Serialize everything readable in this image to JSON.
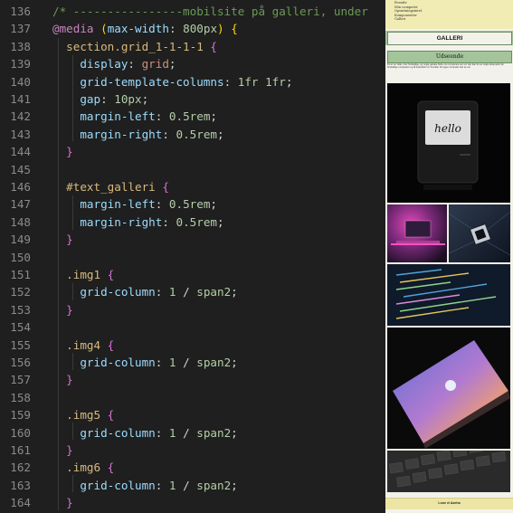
{
  "editor": {
    "lines": [
      {
        "n": "136",
        "tokens": [
          [
            "/* ----------------mobilsite på galleri, under ",
            "c-comment"
          ]
        ]
      },
      {
        "n": "137",
        "tokens": [
          [
            "@media",
            "c-at"
          ],
          [
            " ",
            "c-punc"
          ],
          [
            "(",
            "c-paren"
          ],
          [
            "max-width",
            "c-prop"
          ],
          [
            ": ",
            "c-punc"
          ],
          [
            "800px",
            "c-num"
          ],
          [
            ")",
            "c-paren"
          ],
          [
            " ",
            "c-punc"
          ],
          [
            "{",
            "c-paren"
          ]
        ]
      },
      {
        "n": "138",
        "tokens": [
          [
            "  section.grid_1-1-1-1",
            "c-sel"
          ],
          [
            " ",
            "c-punc"
          ],
          [
            "{",
            "c-brace"
          ]
        ]
      },
      {
        "n": "139",
        "tokens": [
          [
            "    display",
            "c-prop"
          ],
          [
            ": ",
            "c-punc"
          ],
          [
            "grid",
            "c-val"
          ],
          [
            ";",
            "c-punc"
          ]
        ]
      },
      {
        "n": "140",
        "tokens": [
          [
            "    grid-template-columns",
            "c-prop"
          ],
          [
            ": ",
            "c-punc"
          ],
          [
            "1fr 1fr",
            "c-num"
          ],
          [
            ";",
            "c-punc"
          ]
        ]
      },
      {
        "n": "141",
        "tokens": [
          [
            "    gap",
            "c-prop"
          ],
          [
            ": ",
            "c-punc"
          ],
          [
            "10px",
            "c-num"
          ],
          [
            ";",
            "c-punc"
          ]
        ]
      },
      {
        "n": "142",
        "tokens": [
          [
            "    margin-left",
            "c-prop"
          ],
          [
            ": ",
            "c-punc"
          ],
          [
            "0.5rem",
            "c-num"
          ],
          [
            ";",
            "c-punc"
          ]
        ]
      },
      {
        "n": "143",
        "tokens": [
          [
            "    margin-right",
            "c-prop"
          ],
          [
            ": ",
            "c-punc"
          ],
          [
            "0.5rem",
            "c-num"
          ],
          [
            ";",
            "c-punc"
          ]
        ]
      },
      {
        "n": "144",
        "tokens": [
          [
            "  }",
            "c-brace"
          ]
        ]
      },
      {
        "n": "145",
        "tokens": []
      },
      {
        "n": "146",
        "tokens": [
          [
            "  #text_galleri",
            "c-sel"
          ],
          [
            " ",
            "c-punc"
          ],
          [
            "{",
            "c-brace"
          ]
        ]
      },
      {
        "n": "147",
        "tokens": [
          [
            "    margin-left",
            "c-prop"
          ],
          [
            ": ",
            "c-punc"
          ],
          [
            "0.5rem",
            "c-num"
          ],
          [
            ";",
            "c-punc"
          ]
        ]
      },
      {
        "n": "148",
        "tokens": [
          [
            "    margin-right",
            "c-prop"
          ],
          [
            ": ",
            "c-punc"
          ],
          [
            "0.5rem",
            "c-num"
          ],
          [
            ";",
            "c-punc"
          ]
        ]
      },
      {
        "n": "149",
        "tokens": [
          [
            "  }",
            "c-brace"
          ]
        ]
      },
      {
        "n": "150",
        "tokens": []
      },
      {
        "n": "151",
        "tokens": [
          [
            "  .img1",
            "c-sel"
          ],
          [
            " ",
            "c-punc"
          ],
          [
            "{",
            "c-brace"
          ]
        ]
      },
      {
        "n": "152",
        "tokens": [
          [
            "    grid-column",
            "c-prop"
          ],
          [
            ": ",
            "c-punc"
          ],
          [
            "1",
            "c-num"
          ],
          [
            " / ",
            "c-punc"
          ],
          [
            "span2",
            "c-num"
          ],
          [
            ";",
            "c-punc"
          ]
        ]
      },
      {
        "n": "153",
        "tokens": [
          [
            "  }",
            "c-brace"
          ]
        ]
      },
      {
        "n": "154",
        "tokens": []
      },
      {
        "n": "155",
        "tokens": [
          [
            "  .img4",
            "c-sel"
          ],
          [
            " ",
            "c-punc"
          ],
          [
            "{",
            "c-brace"
          ]
        ]
      },
      {
        "n": "156",
        "tokens": [
          [
            "    grid-column",
            "c-prop"
          ],
          [
            ": ",
            "c-punc"
          ],
          [
            "1",
            "c-num"
          ],
          [
            " / ",
            "c-punc"
          ],
          [
            "span2",
            "c-num"
          ],
          [
            ";",
            "c-punc"
          ]
        ]
      },
      {
        "n": "157",
        "tokens": [
          [
            "  }",
            "c-brace"
          ]
        ]
      },
      {
        "n": "158",
        "tokens": []
      },
      {
        "n": "159",
        "tokens": [
          [
            "  .img5",
            "c-sel"
          ],
          [
            " ",
            "c-punc"
          ],
          [
            "{",
            "c-brace"
          ]
        ]
      },
      {
        "n": "160",
        "tokens": [
          [
            "    grid-column",
            "c-prop"
          ],
          [
            ": ",
            "c-punc"
          ],
          [
            "1",
            "c-num"
          ],
          [
            " / ",
            "c-punc"
          ],
          [
            "span2",
            "c-num"
          ],
          [
            ";",
            "c-punc"
          ]
        ]
      },
      {
        "n": "161",
        "tokens": [
          [
            "  }",
            "c-brace"
          ]
        ]
      },
      {
        "n": "162",
        "tokens": [
          [
            "  .img6",
            "c-sel"
          ],
          [
            " ",
            "c-punc"
          ],
          [
            "{",
            "c-brace"
          ]
        ]
      },
      {
        "n": "163",
        "tokens": [
          [
            "    grid-column",
            "c-prop"
          ],
          [
            ": ",
            "c-punc"
          ],
          [
            "1",
            "c-num"
          ],
          [
            " / ",
            "c-punc"
          ],
          [
            "span2",
            "c-num"
          ],
          [
            ";",
            "c-punc"
          ]
        ]
      },
      {
        "n": "164",
        "tokens": [
          [
            "  }",
            "c-brace"
          ]
        ]
      }
    ]
  },
  "preview": {
    "menu_items": [
      "Forside",
      "Min computer",
      "Opsætningsintet",
      "Komponenter",
      "Galleri"
    ],
    "section_title": "GALLERI",
    "heading": "Udseende",
    "intro": "Du er en vilde, hvor forskellige, og nogle ganske flotte min computere ser ud. Her kan du se nogle eksempler på forskellige computere og få inspiration til, hvordan din egen computer kan se ud.",
    "hello_text": "hello",
    "footer": "Lone el Aseha",
    "colors": {
      "menu_bg": "#f1ebb4",
      "section_bg": "#a4c59a",
      "page_bg": "#f3f2ea"
    },
    "images": [
      {
        "name": "gallery-image-retro-mac",
        "desc": "vintage-computer"
      },
      {
        "name": "gallery-image-pink-desk",
        "desc": "pink-desk"
      },
      {
        "name": "gallery-image-cpu-chip",
        "desc": "cpu-chip"
      },
      {
        "name": "gallery-image-code-screen",
        "desc": "code-screen"
      },
      {
        "name": "gallery-image-macbook",
        "desc": "macbook-gradient"
      },
      {
        "name": "gallery-image-keyboard",
        "desc": "keyboard"
      }
    ]
  }
}
